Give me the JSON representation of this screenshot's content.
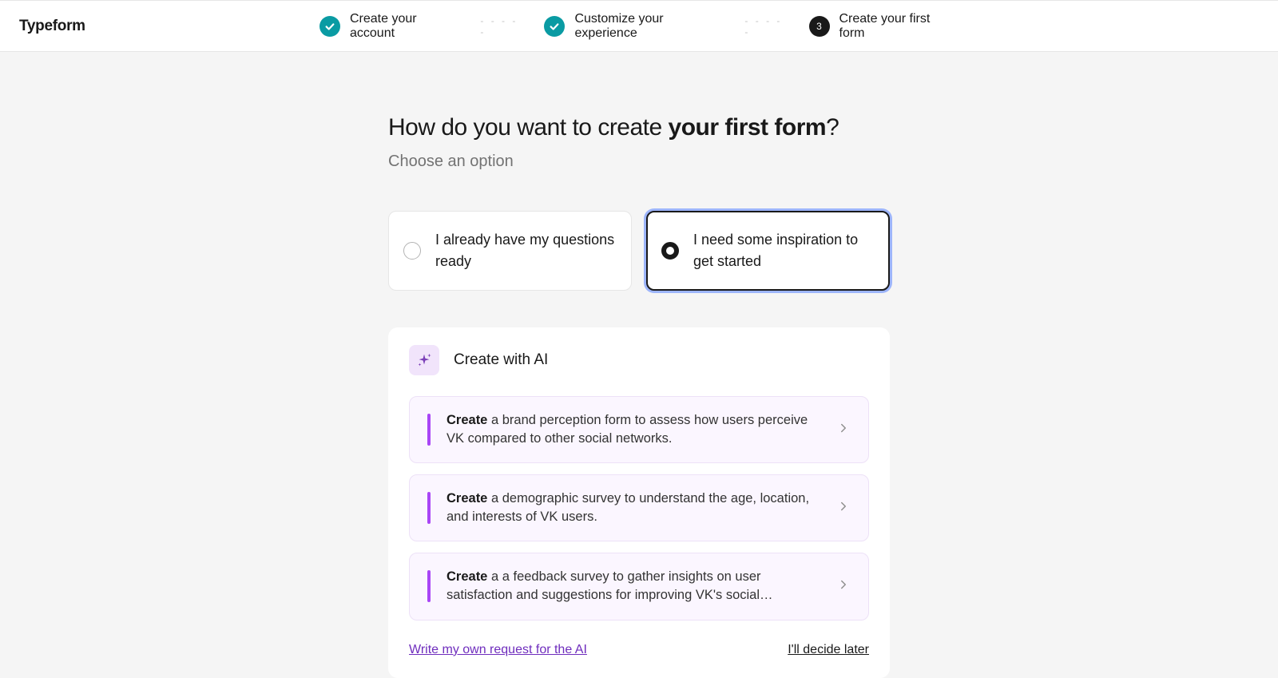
{
  "header": {
    "logo": "Typeform",
    "steps": [
      {
        "label": "Create your account",
        "state": "done"
      },
      {
        "label": "Customize your experience",
        "state": "done"
      },
      {
        "label": "Create your first form",
        "state": "current",
        "number": "3"
      }
    ]
  },
  "main": {
    "title_prefix": "How do you want to create ",
    "title_strong": "your first form",
    "title_suffix": "?",
    "subtitle": "Choose an option",
    "options": [
      {
        "label": "I already have my questions ready",
        "selected": false
      },
      {
        "label": "I need some inspiration to get started",
        "selected": true
      }
    ]
  },
  "ai": {
    "title": "Create with AI",
    "prefix": "Create",
    "suggestions": [
      " a brand perception form to assess how users perceive VK compared to other social networks.",
      " a demographic survey to understand the age, location, and interests of VK users.",
      " a a feedback survey to gather insights on user satisfaction and suggestions for improving VK's social…"
    ],
    "write_own": "Write my own request for the AI",
    "decide_later": "I'll decide later"
  }
}
